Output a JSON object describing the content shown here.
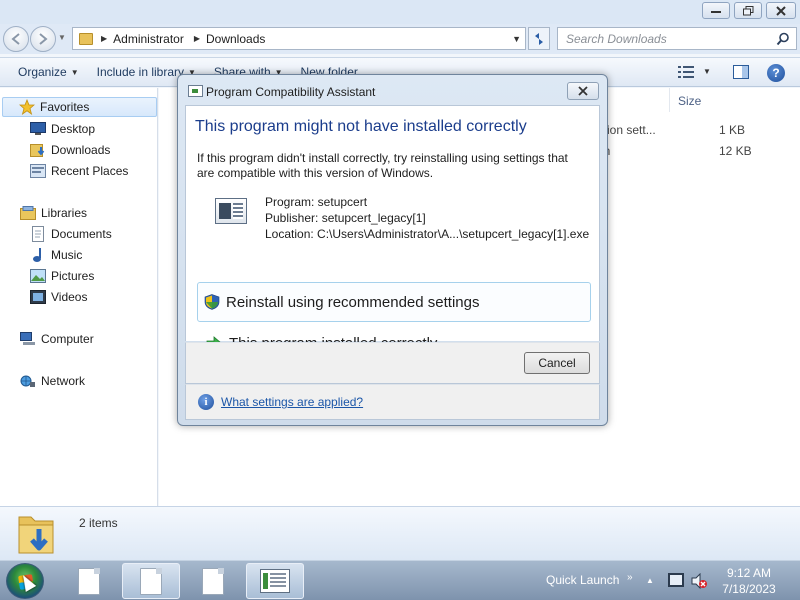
{
  "explorer": {
    "window_buttons": [
      "minimize",
      "maximize",
      "close"
    ],
    "breadcrumb": [
      "Administrator",
      "Downloads"
    ],
    "search_placeholder": "Search Downloads",
    "toolbar": {
      "organize": "Organize",
      "include_in_library": "Include in library",
      "share_with": "Share with",
      "new_folder": "New folder"
    },
    "nav": {
      "favorites": "Favorites",
      "desktop": "Desktop",
      "downloads": "Downloads",
      "recent_places": "Recent Places",
      "libraries": "Libraries",
      "documents": "Documents",
      "music": "Music",
      "pictures": "Pictures",
      "videos": "Videos",
      "computer": "Computer",
      "network": "Network"
    },
    "columns": {
      "size": "Size"
    },
    "files": [
      {
        "name_fragment": "ation sett...",
        "size": "1 KB"
      },
      {
        "name_fragment": "on",
        "size": "12 KB"
      }
    ],
    "details": {
      "item_count": "2 items"
    }
  },
  "dialog": {
    "title": "Program Compatibility Assistant",
    "heading": "This program might not have installed correctly",
    "message": "If this program didn't install correctly, try reinstalling using settings that are compatible with this version of Windows.",
    "program": "Program: setupcert",
    "publisher": "Publisher: setupcert_legacy[1]",
    "location": "Location: C:\\Users\\Administrator\\A...\\setupcert_legacy[1].exe",
    "option_reinstall": "Reinstall using recommended settings",
    "option_ok": "This program installed correctly",
    "cancel": "Cancel",
    "settings_link": "What settings are applied?"
  },
  "taskbar": {
    "quick_launch": "Quick Launch",
    "time": "9:12 AM",
    "date": "7/18/2023"
  }
}
